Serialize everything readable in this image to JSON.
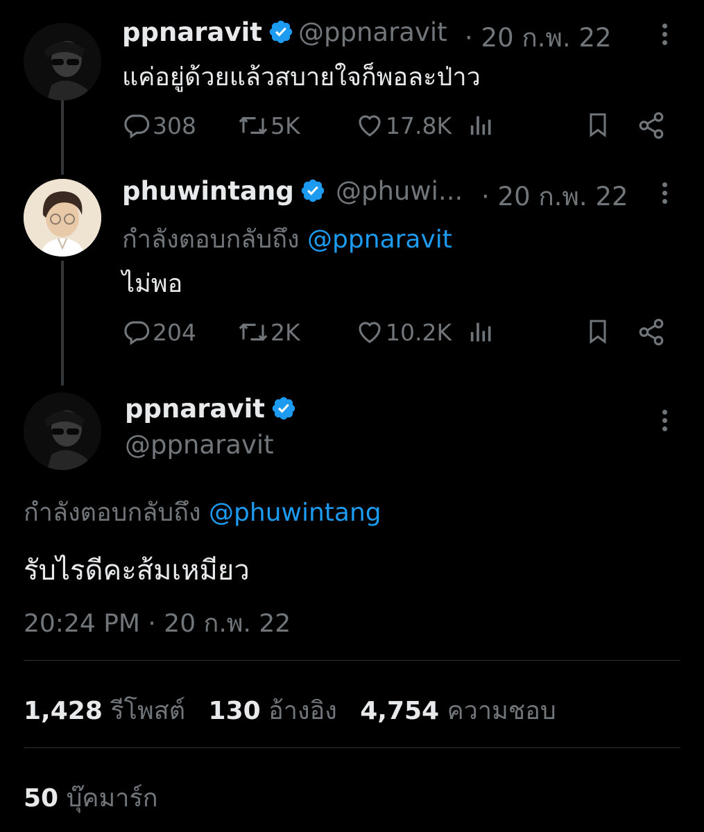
{
  "tweet1": {
    "name": "ppnaravit",
    "handle": "@ppnaravit",
    "date": "· 20 ก.พ. 22",
    "text": "แค่อยู่ด้วยแล้วสบายใจก็พอละป่าว",
    "replies": "308",
    "retweets": "5K",
    "likes": "17.8K"
  },
  "tweet2": {
    "name": "phuwintang",
    "handle": "@phuwi...",
    "date": "· 20 ก.พ. 22",
    "reply_prefix": "กำลังตอบกลับถึง",
    "reply_mention": "@ppnaravit",
    "text": "ไม่พอ",
    "replies": "204",
    "retweets": "2K",
    "likes": "10.2K"
  },
  "main_tweet": {
    "name": "ppnaravit",
    "handle": "@ppnaravit",
    "reply_prefix": "กำลังตอบกลับถึง",
    "reply_mention": "@phuwintang",
    "text": "รับไรดีคะส้มเหมียว",
    "timestamp": "20:24 PM · 20 ก.พ. 22",
    "stats": {
      "retweets_count": "1,428",
      "retweets_label": "รีโพสต์",
      "quotes_count": "130",
      "quotes_label": "อ้างอิง",
      "likes_count": "4,754",
      "likes_label": "ความชอบ",
      "bookmarks_count": "50",
      "bookmarks_label": "บุ๊คมาร์ก"
    }
  },
  "colors": {
    "background": "#000000",
    "text": "#e7e9ea",
    "muted": "#71767b",
    "accent": "#1d9bf0",
    "divider": "#2f3336"
  },
  "icons": [
    "verified-badge-icon",
    "reply-icon",
    "retweet-icon",
    "like-icon",
    "views-icon",
    "bookmark-icon",
    "share-icon",
    "more-icon"
  ]
}
